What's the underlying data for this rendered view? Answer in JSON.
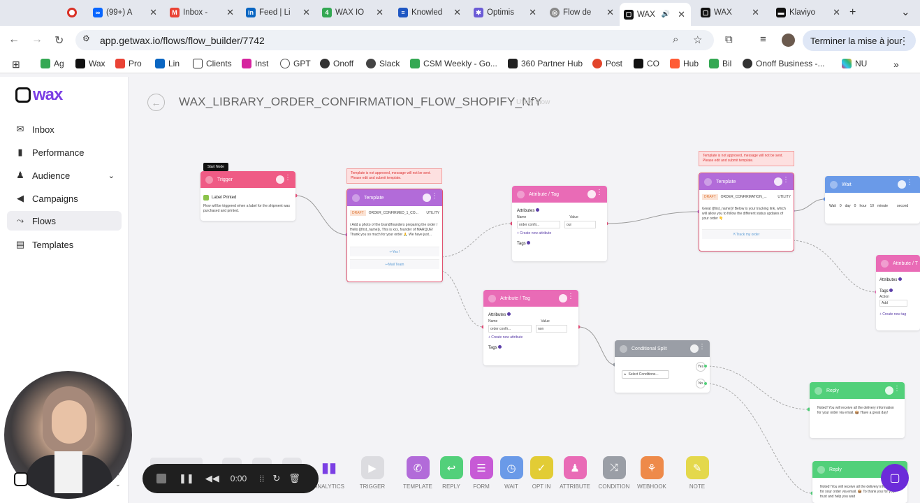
{
  "tabs": [
    {
      "label": "",
      "color": "#d93025",
      "icon": "record-icon"
    },
    {
      "label": "(99+) A",
      "color": "#0866ff",
      "icon": "meta-icon"
    },
    {
      "label": "Inbox - ",
      "color": "#ea4335",
      "icon": "gmail-icon"
    },
    {
      "label": "Feed | Li",
      "color": "#0a66c2",
      "icon": "linkedin-icon"
    },
    {
      "label": "WAX IO",
      "color": "#34a853",
      "icon": "sheets-icon"
    },
    {
      "label": "Knowled",
      "color": "#1f57c3",
      "icon": "intercom-icon"
    },
    {
      "label": "Optimis",
      "color": "#6b5bd6",
      "icon": "gear-icon"
    },
    {
      "label": "Flow de",
      "color": "#777777",
      "icon": "globe-icon"
    },
    {
      "label": "WAX",
      "color": "#111111",
      "icon": "wax-icon",
      "active": true
    },
    {
      "label": "WAX",
      "color": "#111111",
      "icon": "wax-icon"
    },
    {
      "label": "Klaviyo",
      "color": "#111111",
      "icon": "klaviyo-icon"
    }
  ],
  "address": {
    "url": "app.getwax.io/flows/flow_builder/7742",
    "update_label": "Terminer la mise à jour"
  },
  "bookmarks": [
    "Ag",
    "Wax",
    "Pro",
    "Lin",
    "Clients",
    "Inst",
    "GPT",
    "Onoff",
    "Slack",
    "CSM Weekly - Go...",
    "360 Partner Hub",
    "Post",
    "CO",
    "Hub",
    "Bil",
    "Onoff Business -...",
    "NU"
  ],
  "sidebar": {
    "brand": "wax",
    "items": [
      {
        "label": "Inbox",
        "icon": "inbox-icon"
      },
      {
        "label": "Performance",
        "icon": "bar-chart-icon"
      },
      {
        "label": "Audience",
        "icon": "audience-icon"
      },
      {
        "label": "Campaigns",
        "icon": "megaphone-icon"
      },
      {
        "label": "Flows",
        "icon": "flow-icon",
        "active": true
      },
      {
        "label": "Templates",
        "icon": "templates-icon"
      }
    ]
  },
  "flow": {
    "title": "WAX_LIBRARY_ORDER_CONFIRMATION_FLOW_SHOPIFY_NfY",
    "subtitle": "Utility Flow"
  },
  "nodes": {
    "start_badge": "Start Node",
    "trigger": {
      "title": "Trigger",
      "event": "Label Printed",
      "desc": "Flow will be triggered when a label for the shipment was purchased and printed."
    },
    "warn1": "Template is not approved, message will not be sent. Please edit and submit template.",
    "template1": {
      "title": "Template",
      "status": "DRAFT",
      "name": "ORDER_CONFIRMED_1_CO...",
      "category": "UTILITY",
      "body": "/ Add a photo of the brand/founders preparing the order / Hello {{first_name}}, This is xxx, founder of MARQUE! Thank you so much for your order 🙏 We have just...",
      "btn1": "Yes !",
      "btn2": "Mail Team"
    },
    "attr1": {
      "title": "Attribute / Tag",
      "attributes": "Attributes",
      "name_label": "Name",
      "value_label": "Value",
      "name": "order confir...",
      "value": "oui",
      "create": "+ Create new attribute",
      "tags": "Tags"
    },
    "attr2": {
      "title": "Attribute / Tag",
      "attributes": "Attributes",
      "name_label": "Name",
      "value_label": "Value",
      "name": "order confir...",
      "value": "non",
      "create": "+ Create new attribute",
      "tags": "Tags"
    },
    "warn2": "Template is not approved, message will not be sent. Please edit and submit template.",
    "template2": {
      "title": "Template",
      "status": "DRAFT",
      "name": "ORDER_CONFIRMATION_...",
      "category": "UTILITY",
      "body": "Great {{first_name}}! Below is your tracking link, which will allow you to follow the different status updates of your order 👇",
      "btn": "Track my order"
    },
    "wait": {
      "title": "Wait",
      "w1": "Wait",
      "d": "0",
      "dl": "day",
      "h": "0",
      "hl": "hour",
      "m": "10",
      "ml": "minute",
      "s": "second"
    },
    "attr3": {
      "title": "Attribute / T",
      "attributes": "Attributes",
      "tags": "Tags",
      "action_label": "Action",
      "action": "Add",
      "create": "+ Create new tag"
    },
    "cond": {
      "title": "Conditional Split",
      "yes": "Yes",
      "no": "No",
      "select": "Select Conditions..."
    },
    "reply1": {
      "title": "Reply",
      "body": "Noted! You will receive all the delivery information for your order via email. 📦 Have a great day!"
    },
    "reply2": {
      "title": "Reply",
      "body": "Noted! You will receive all the delivery information for your order via email. 📦 To thank you for your trust and help you wait"
    }
  },
  "toolbar": [
    {
      "label": "ANALYTICS",
      "color": "#7b3fe4",
      "icon": "analytics-icon"
    },
    {
      "label": "TRIGGER",
      "color": "#d5d5d8",
      "icon": "trigger-icon"
    },
    {
      "label": "TEMPLATE",
      "color": "#b26bd9",
      "icon": "whatsapp-icon"
    },
    {
      "label": "REPLY",
      "color": "#52d07a",
      "icon": "reply-icon"
    },
    {
      "label": "FORM",
      "color": "#c75ad6",
      "icon": "form-icon"
    },
    {
      "label": "WAIT",
      "color": "#6a9ae8",
      "icon": "clock-icon"
    },
    {
      "label": "OPT IN",
      "color": "#e2cc35",
      "icon": "check-circle-icon"
    },
    {
      "label": "ATTRIBUTE",
      "color": "#e96bb6",
      "icon": "user-icon"
    },
    {
      "label": "CONDITION",
      "color": "#9a9ea6",
      "icon": "split-icon"
    },
    {
      "label": "WEBHOOK",
      "color": "#ee8a4a",
      "icon": "webhook-icon"
    },
    {
      "label": "NOTE",
      "color": "#e4d84c",
      "icon": "note-icon"
    }
  ],
  "recorder": {
    "time": "0:00"
  }
}
